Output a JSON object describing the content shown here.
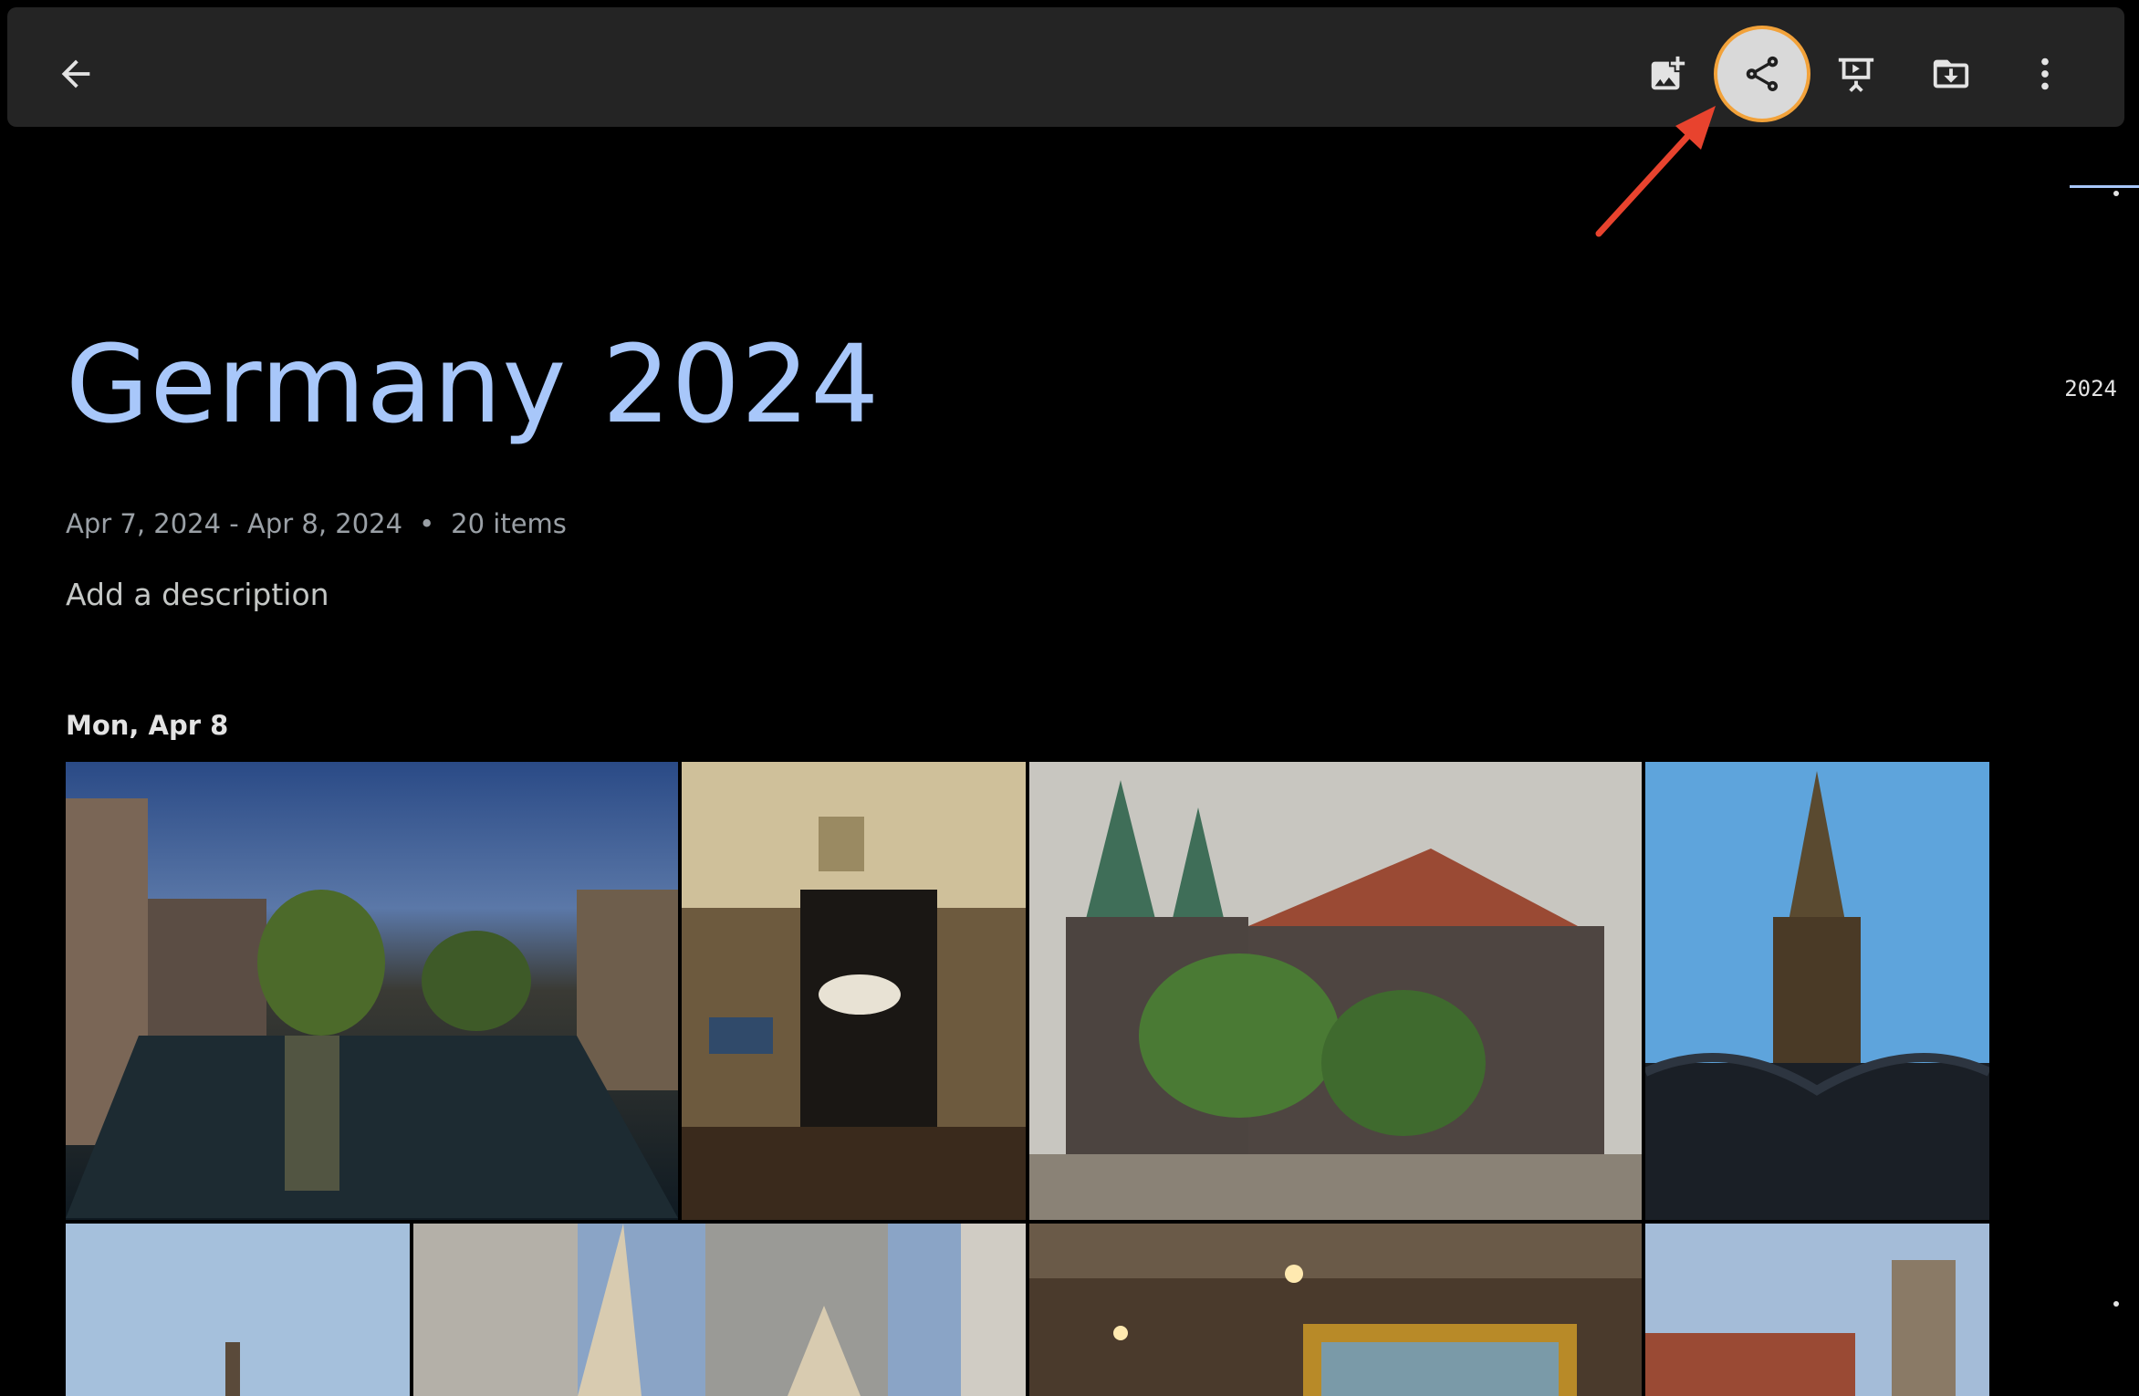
{
  "toolbar": {
    "back_icon": "arrow-back-icon",
    "actions": [
      {
        "name": "add-photos",
        "icon": "add-photo-icon"
      },
      {
        "name": "share",
        "icon": "share-icon",
        "highlighted": true
      },
      {
        "name": "slideshow",
        "icon": "slideshow-icon"
      },
      {
        "name": "download",
        "icon": "download-folder-icon"
      },
      {
        "name": "more-options",
        "icon": "more-vert-icon"
      }
    ]
  },
  "album": {
    "title": "Germany 2024",
    "date_range": "Apr 7, 2024 - Apr 8, 2024",
    "separator": "•",
    "item_count": "20 items",
    "description_placeholder": "Add a description"
  },
  "timeline": {
    "year": "2024"
  },
  "sections": [
    {
      "date": "Mon, Apr 8",
      "photos": [
        {
          "subject": "river canal at dusk"
        },
        {
          "subject": "restaurant interior with sign"
        },
        {
          "subject": "gothic church with twin spires"
        },
        {
          "subject": "ornate fountain spire"
        },
        {
          "subject": "church spire at dusk"
        },
        {
          "subject": "building with parasols"
        },
        {
          "subject": "restaurant interior with lights"
        },
        {
          "subject": "old town tower"
        }
      ]
    }
  ],
  "annotation": {
    "color": "#e8432e",
    "highlight_color": "#f2a23a"
  },
  "colors": {
    "title": "#a8c7fa",
    "background": "#000000",
    "toolbar": "#242424"
  }
}
